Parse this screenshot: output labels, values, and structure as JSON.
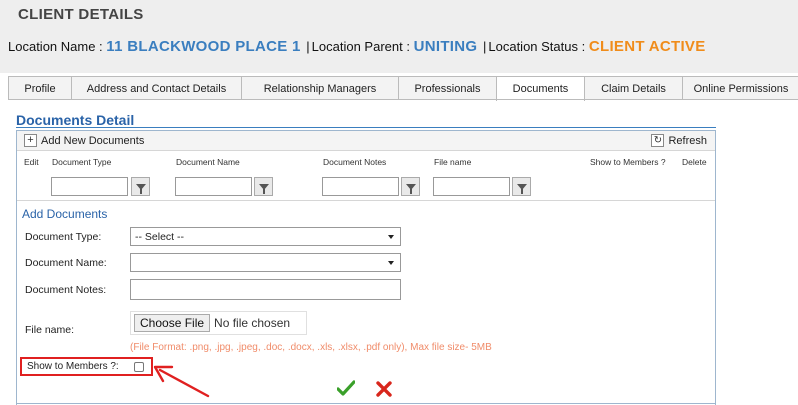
{
  "header": {
    "title": "CLIENT DETAILS",
    "location_name_label": "Location Name :",
    "location_name_value": "11 BLACKWOOD PLACE 1",
    "location_parent_label": "Location Parent :",
    "location_parent_value": "UNITING",
    "location_status_label": "Location Status :",
    "location_status_value": "CLIENT ACTIVE",
    "separator": "|"
  },
  "tabs": [
    {
      "label": "Profile",
      "active": false
    },
    {
      "label": "Address and Contact Details",
      "active": false
    },
    {
      "label": "Relationship Managers",
      "active": false
    },
    {
      "label": "Professionals",
      "active": false
    },
    {
      "label": "Documents",
      "active": true
    },
    {
      "label": "Claim Details",
      "active": false
    },
    {
      "label": "Online Permissions",
      "active": false
    }
  ],
  "documents": {
    "section_title": "Documents Detail",
    "add_new_label": "Add New Documents",
    "refresh_label": "Refresh",
    "columns": {
      "edit": "Edit",
      "document_type": "Document Type",
      "document_name": "Document Name",
      "document_notes": "Document Notes",
      "file_name": "File name",
      "show_to_members": "Show to Members ?",
      "delete": "Delete"
    }
  },
  "add_form": {
    "title": "Add Documents",
    "document_type_label": "Document Type:",
    "document_type_value": "-- Select --",
    "document_name_label": "Document Name:",
    "document_name_value": "",
    "document_notes_label": "Document Notes:",
    "file_name_label": "File name:",
    "choose_file_label": "Choose File",
    "no_file_label": "No file chosen",
    "file_format_note": "(File Format: .png, .jpg, .jpeg, .doc, .docx, .xls, .xlsx, .pdf only), Max file size- 5MB",
    "show_to_members_label": "Show to Members ?:",
    "show_to_members_checked": false
  },
  "colors": {
    "accent_blue": "#3a7ebf",
    "status_orange": "#f08c1a",
    "highlight_red": "#e02020",
    "ok_green": "#3aa02a",
    "cancel_red": "#d8261c"
  },
  "icons": {
    "add": "plus-icon",
    "refresh": "refresh-icon",
    "filter": "filter-icon",
    "ok": "checkmark-icon",
    "cancel": "cross-icon",
    "annotation": "arrow-icon"
  }
}
